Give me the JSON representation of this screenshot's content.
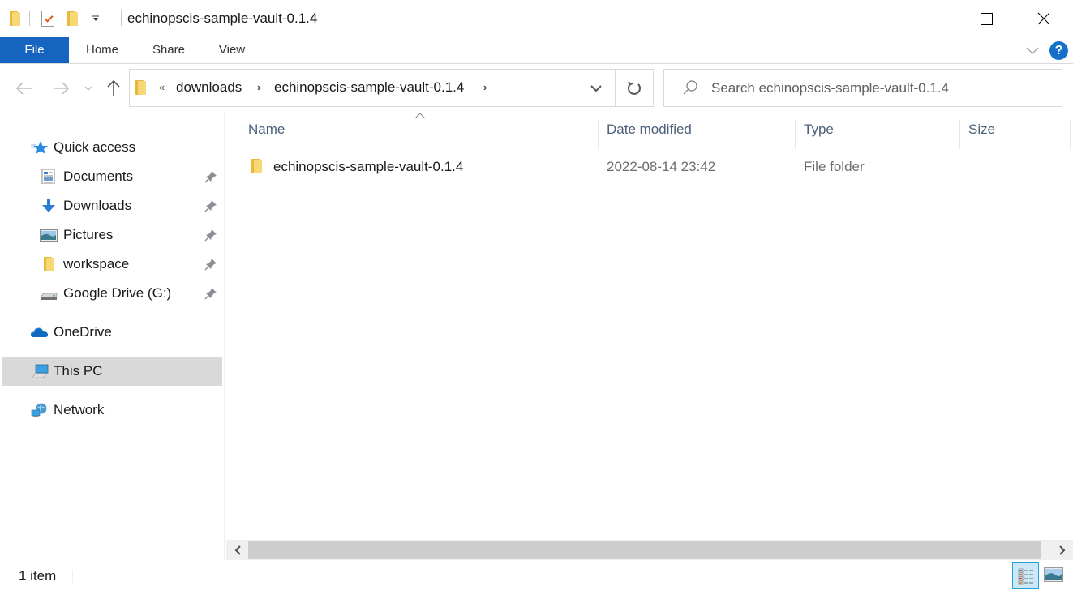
{
  "window": {
    "title": "echinopscis-sample-vault-0.1.4",
    "controls": {
      "minimize": "minimize",
      "maximize": "maximize",
      "close": "close"
    }
  },
  "quick_access_toolbar": {
    "icons": [
      "folder-icon",
      "properties-icon",
      "new-folder-icon",
      "customize-dropdown-icon"
    ]
  },
  "ribbon": {
    "tabs": [
      {
        "label": "File",
        "active": true
      },
      {
        "label": "Home"
      },
      {
        "label": "Share"
      },
      {
        "label": "View"
      }
    ],
    "help_label": "?"
  },
  "navigation": {
    "back": "back",
    "forward": "forward",
    "up": "up",
    "address": {
      "overflow": "«",
      "crumbs": [
        "downloads",
        "echinopscis-sample-vault-0.1.4"
      ],
      "separator": "›"
    },
    "search": {
      "placeholder": "Search echinopscis-sample-vault-0.1.4",
      "value": ""
    }
  },
  "sidebar": {
    "items": [
      {
        "label": "Quick access",
        "icon": "star-icon",
        "level": 0
      },
      {
        "label": "Documents",
        "icon": "documents-icon",
        "level": 1,
        "pinned": true
      },
      {
        "label": "Downloads",
        "icon": "downloads-icon",
        "level": 1,
        "pinned": true
      },
      {
        "label": "Pictures",
        "icon": "pictures-icon",
        "level": 1,
        "pinned": true
      },
      {
        "label": "workspace",
        "icon": "folder-icon",
        "level": 1,
        "pinned": true
      },
      {
        "label": "Google Drive (G:)",
        "icon": "drive-icon",
        "level": 1,
        "pinned": true
      },
      {
        "label": "OneDrive",
        "icon": "cloud-icon",
        "level": 0
      },
      {
        "label": "This PC",
        "icon": "computer-icon",
        "level": 0,
        "selected": true
      },
      {
        "label": "Network",
        "icon": "network-icon",
        "level": 0
      }
    ]
  },
  "file_list": {
    "columns": [
      "Name",
      "Date modified",
      "Type",
      "Size"
    ],
    "sort_column": "Name",
    "rows": [
      {
        "name": "echinopscis-sample-vault-0.1.4",
        "date_modified": "2022-08-14 23:42",
        "type": "File folder",
        "size": ""
      }
    ]
  },
  "status_bar": {
    "item_count": "1 item",
    "views": [
      "details-view",
      "large-icons-view"
    ],
    "active_view": "details-view"
  },
  "colors": {
    "file_tab": "#1565c0",
    "selected_nav": "#d9d9d9",
    "header_text": "#4c607a",
    "active_view_bg": "#cce8f6",
    "active_view_border": "#26a0da"
  }
}
